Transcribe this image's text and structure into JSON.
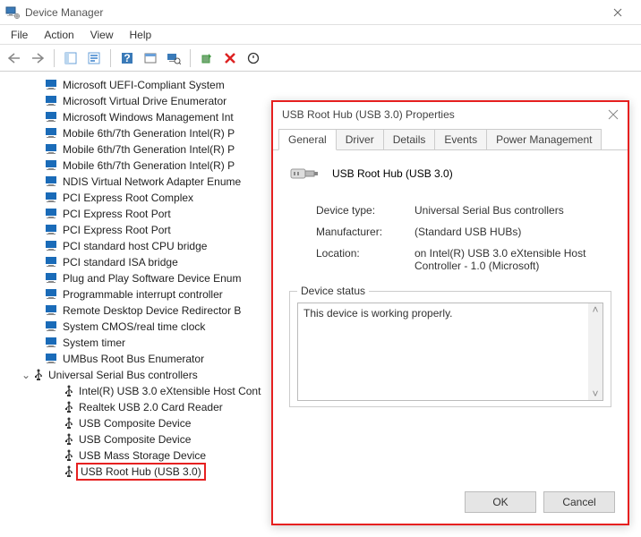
{
  "window": {
    "title": "Device Manager"
  },
  "menus": {
    "file": "File",
    "action": "Action",
    "view": "View",
    "help": "Help"
  },
  "tree": {
    "items": [
      "Microsoft UEFI-Compliant System",
      "Microsoft Virtual Drive Enumerator",
      "Microsoft Windows Management Int",
      "Mobile 6th/7th Generation Intel(R) P",
      "Mobile 6th/7th Generation Intel(R) P",
      "Mobile 6th/7th Generation Intel(R) P",
      "NDIS Virtual Network Adapter Enume",
      "PCI Express Root Complex",
      "PCI Express Root Port",
      "PCI Express Root Port",
      "PCI standard host CPU bridge",
      "PCI standard ISA bridge",
      "Plug and Play Software Device Enum",
      "Programmable interrupt controller",
      "Remote Desktop Device Redirector B",
      "System CMOS/real time clock",
      "System timer",
      "UMBus Root Bus Enumerator"
    ],
    "usb_category": "Universal Serial Bus controllers",
    "usb_items": [
      "Intel(R) USB 3.0 eXtensible Host Cont",
      "Realtek USB 2.0 Card Reader",
      "USB Composite Device",
      "USB Composite Device",
      "USB Mass Storage Device",
      "USB Root Hub (USB 3.0)"
    ]
  },
  "dialog": {
    "title": "USB Root Hub (USB 3.0) Properties",
    "tabs": {
      "general": "General",
      "driver": "Driver",
      "details": "Details",
      "events": "Events",
      "power": "Power Management"
    },
    "name": "USB Root Hub (USB 3.0)",
    "rows": {
      "type_k": "Device type:",
      "type_v": "Universal Serial Bus controllers",
      "mfr_k": "Manufacturer:",
      "mfr_v": "(Standard USB HUBs)",
      "loc_k": "Location:",
      "loc_v": "on Intel(R) USB 3.0 eXtensible Host Controller - 1.0 (Microsoft)"
    },
    "status_legend": "Device status",
    "status_text": "This device is working properly.",
    "ok": "OK",
    "cancel": "Cancel"
  }
}
